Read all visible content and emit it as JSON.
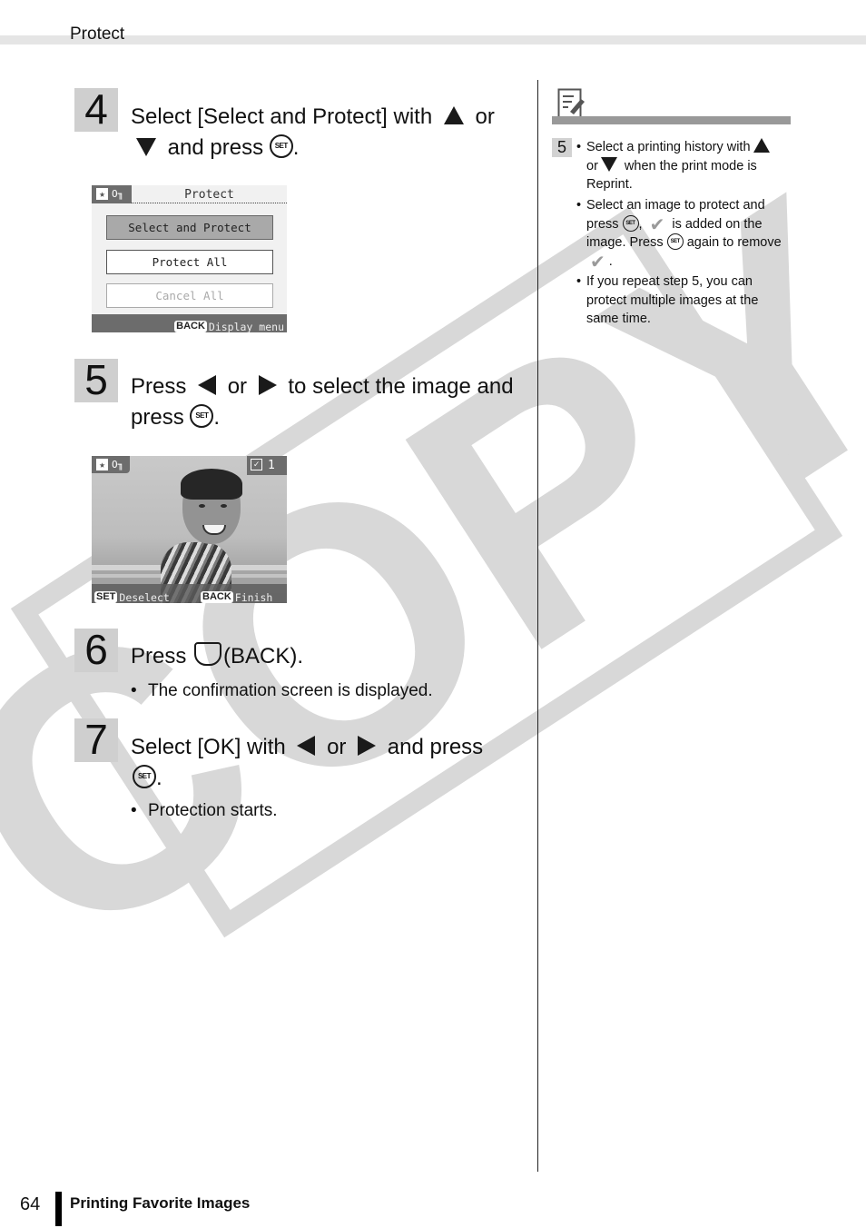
{
  "header": {
    "section_title": "Protect"
  },
  "steps": [
    {
      "number": "4",
      "text_parts": [
        "Select [Select and Protect] with",
        "or",
        "and press",
        "."
      ],
      "icons": [
        "up-arrow",
        "down-arrow",
        "set-button"
      ]
    },
    {
      "number": "5",
      "text_parts": [
        "Press",
        "or",
        "to select the image and",
        "press",
        "."
      ],
      "icons": [
        "left-arrow",
        "right-arrow",
        "set-button"
      ]
    },
    {
      "number": "6",
      "text_parts": [
        "Press",
        "(BACK)",
        "."
      ],
      "icons": [
        "back-button"
      ],
      "bullets": [
        "The confirmation screen is displayed."
      ]
    },
    {
      "number": "7",
      "text_parts": [
        "Select [OK] with",
        "or",
        "and press",
        "."
      ],
      "icons": [
        "left-arrow",
        "right-arrow",
        "set-button"
      ],
      "bullets": [
        "Protection starts."
      ]
    }
  ],
  "screen_protect_menu": {
    "title": "Protect",
    "options": [
      {
        "label": "Select and Protect",
        "state": "selected"
      },
      {
        "label": "Protect All",
        "state": "enabled"
      },
      {
        "label": "Cancel All",
        "state": "disabled"
      }
    ],
    "footer_key": "BACK",
    "footer_label": "Display menu"
  },
  "screen_select_image": {
    "protected_count": "1",
    "check_glyph": "✓",
    "footer_left_key": "SET",
    "footer_left_label": "Deselect",
    "footer_right_key": "BACK",
    "footer_right_label": "Finish"
  },
  "notes": {
    "step_ref": "5",
    "items": [
      {
        "parts": [
          "Select a printing history with",
          "or",
          "when the print mode is Reprint."
        ]
      },
      {
        "parts": [
          "Select an image to protect and press",
          ",",
          "is added on the image. Press",
          "again to remove",
          "."
        ]
      },
      {
        "parts": [
          "If you repeat step 5, you can protect multiple images at the same time."
        ]
      }
    ]
  },
  "watermark": {
    "text": "COPY",
    "color": "#d8d8d8"
  },
  "icons": {
    "set_label": "SET",
    "bullet": "•",
    "star": "★",
    "key": "O╖",
    "check": "✔"
  },
  "footer": {
    "page_number": "64",
    "chapter_title": "Printing Favorite Images"
  }
}
